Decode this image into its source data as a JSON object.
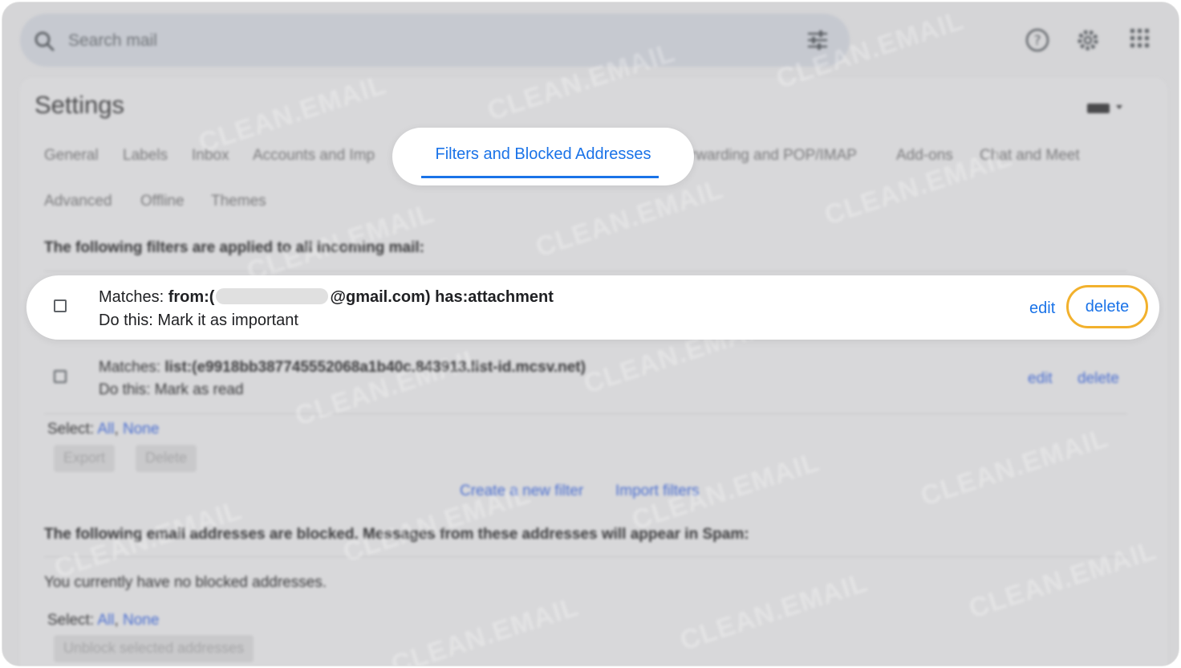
{
  "search": {
    "placeholder": "Search mail"
  },
  "header": {
    "title": "Settings"
  },
  "tabs": [
    {
      "label": "General"
    },
    {
      "label": "Labels"
    },
    {
      "label": "Inbox"
    },
    {
      "label": "Accounts and Imp"
    },
    {
      "label": "Filters and Blocked Addresses",
      "active": true
    },
    {
      "label": "rwarding and POP/IMAP"
    },
    {
      "label": "Add-ons"
    },
    {
      "label": "Chat and Meet"
    },
    {
      "label": "Advanced"
    },
    {
      "label": "Offline"
    },
    {
      "label": "Themes"
    }
  ],
  "filters_section": {
    "heading": "The following filters are applied to all incoming mail:",
    "filters": [
      {
        "matches_label": "Matches: ",
        "matches_prefix": "from:(",
        "matches_suffix": "@gmail.com) has:attachment",
        "action": "Do this: Mark it as important",
        "edit": "edit",
        "delete": "delete"
      },
      {
        "matches_label": "Matches: ",
        "matches_value": "list:(e9918bb387745552068a1b40c.843913.list-id.mcsv.net)",
        "action": "Do this: Mark as read",
        "edit": "edit",
        "delete": "delete"
      }
    ],
    "select_label": "Select: ",
    "select_all": "All",
    "select_sep": ", ",
    "select_none": "None",
    "export_button": "Export",
    "delete_button": "Delete",
    "create_filter": "Create a new filter",
    "import_filters": "Import filters"
  },
  "blocked_section": {
    "heading": "The following email addresses are blocked. Messages from these addresses will appear in Spam:",
    "empty_message": "You currently have no blocked addresses.",
    "select_label": "Select: ",
    "select_all": "All",
    "select_sep": ", ",
    "select_none": "None",
    "unblock_button": "Unblock selected addresses"
  },
  "watermark": "CLEAN.EMAIL",
  "colors": {
    "accent": "#1a73e8",
    "highlight_ring": "#f2b12d"
  }
}
